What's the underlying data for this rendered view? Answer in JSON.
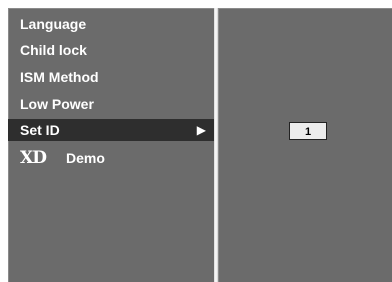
{
  "menu": {
    "items": [
      {
        "label": "Language"
      },
      {
        "label": "Child lock"
      },
      {
        "label": "ISM Method"
      },
      {
        "label": "Low Power"
      },
      {
        "label": "Set ID",
        "arrow": "▶"
      },
      {
        "logo": "XD",
        "label": "Demo"
      }
    ],
    "selected": "Set ID"
  },
  "set_id": {
    "value": "1"
  },
  "colors": {
    "panel": "#6b6b6b",
    "selected_row": "#2e2e2e",
    "text": "#ffffff"
  }
}
